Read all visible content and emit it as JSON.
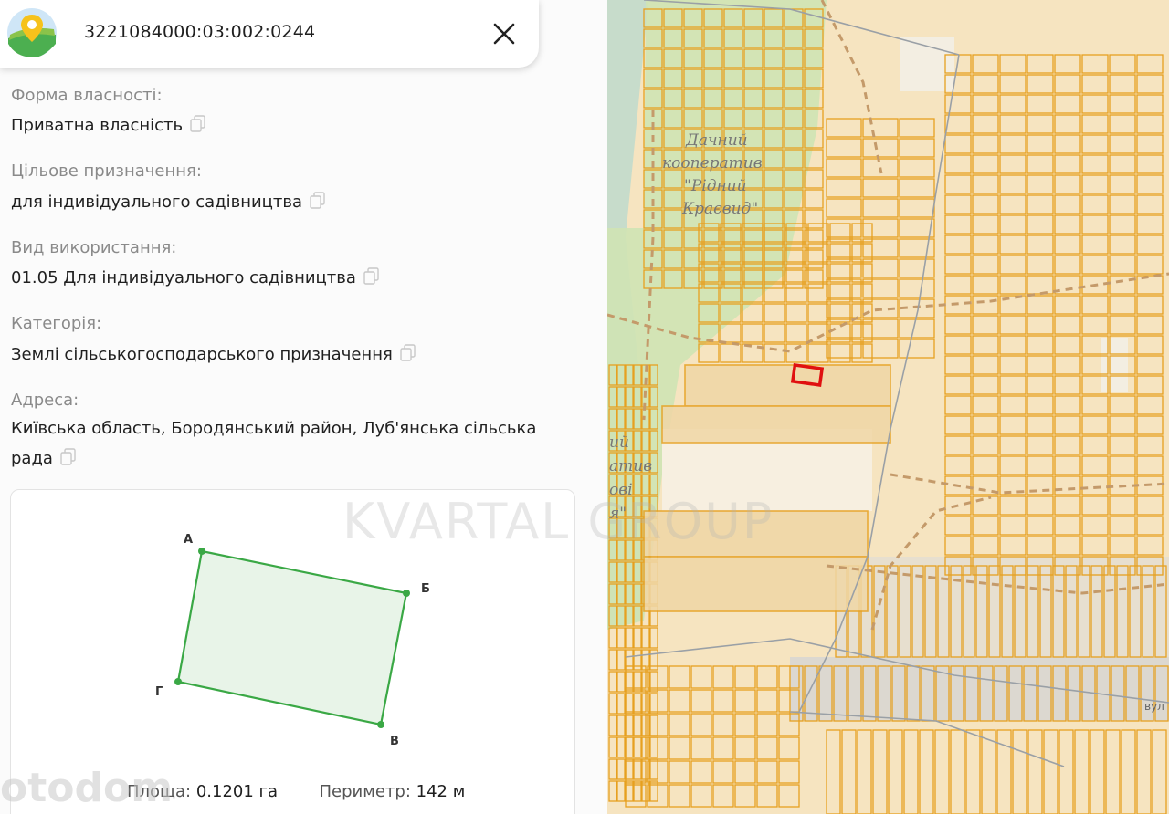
{
  "header": {
    "cadastral_number": "3221084000:03:002:0244"
  },
  "fields": [
    {
      "label": "Форма власності:",
      "value": "Приватна власність"
    },
    {
      "label": "Цільове призначення:",
      "value": "для індивідуального садівництва"
    },
    {
      "label": "Вид використання:",
      "value": "01.05 Для індивідуального садівництва"
    },
    {
      "label": "Категорія:",
      "value": "Землі сільськогосподарського призначення"
    },
    {
      "label": "Адреса:",
      "value_line1": "Київська область, Бородянський район, Луб'янська сільська",
      "value_line2": "рада"
    }
  ],
  "shape": {
    "vertices": {
      "a": "А",
      "b": "Б",
      "v": "В",
      "g": "Г"
    },
    "area_label": "Площа:",
    "area_value": "0.1201 га",
    "perimeter_label": "Периметр:",
    "perimeter_value": "142 м",
    "stroke_color": "#3aa845",
    "fill_color": "#e8f4e8"
  },
  "map": {
    "label_line1": "Дачний",
    "label_line2": "кооператив",
    "label_line3": "\"Рідний",
    "label_line4": "Краєвид\"",
    "edge_text1": "ий",
    "edge_text2": "атив",
    "edge_text3": "ові",
    "edge_text4": "я\"",
    "road_label": "вул",
    "parcel_color": "#e6a020",
    "highlight_color": "#e01010"
  },
  "watermarks": {
    "brand": "KVARTAL GROUP",
    "site": "otodom"
  }
}
